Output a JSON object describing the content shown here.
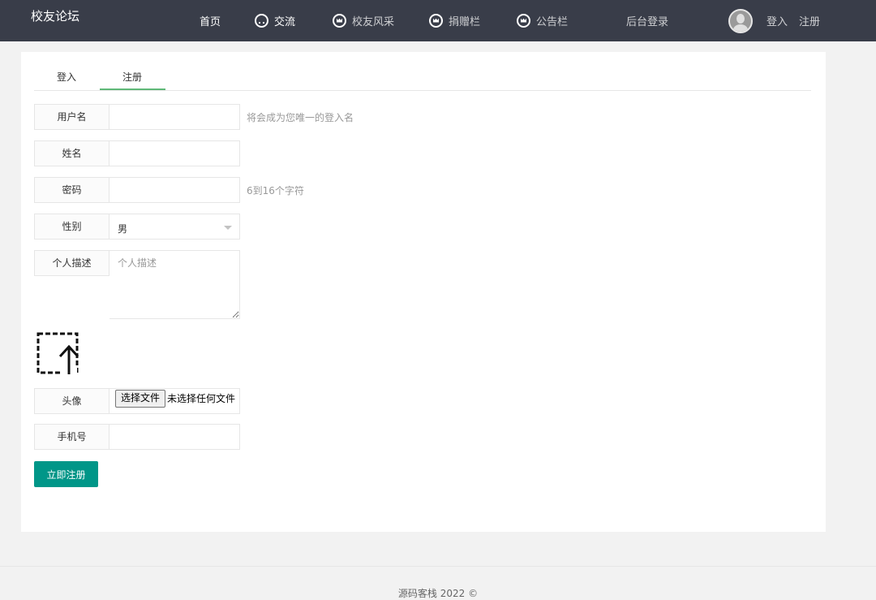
{
  "header": {
    "logo": "校友论坛",
    "nav": [
      {
        "label": "首页",
        "icon": ""
      },
      {
        "label": "交流",
        "icon": "chat-bubble-icon"
      },
      {
        "label": "校友风采",
        "icon": "crown-icon"
      },
      {
        "label": "捐赠栏",
        "icon": "crown-icon"
      },
      {
        "label": "公告栏",
        "icon": "crown-icon"
      },
      {
        "label": "后台登录",
        "icon": ""
      }
    ],
    "user_icon": "avatar-icon",
    "login": "登入",
    "register": "注册"
  },
  "tabs": {
    "login": "登入",
    "register": "注册",
    "active": "注册"
  },
  "form": {
    "username": {
      "label": "用户名",
      "value": "",
      "hint": "将会成为您唯一的登入名"
    },
    "name": {
      "label": "姓名",
      "value": ""
    },
    "password": {
      "label": "密码",
      "value": "",
      "hint": "6到16个字符"
    },
    "gender": {
      "label": "性别",
      "value": "男"
    },
    "description": {
      "label": "个人描述",
      "placeholder": "个人描述"
    },
    "avatar": {
      "label": "头像",
      "icon": "upload-icon",
      "button": "选择文件",
      "status": "未选择任何文件"
    },
    "phone": {
      "label": "手机号",
      "value": ""
    },
    "submit": "立即注册"
  },
  "footer": {
    "text": "源码客栈  2022 ©"
  },
  "colors": {
    "header_bg": "#393d49",
    "accent": "#009688",
    "tab_underline": "#5fb878"
  }
}
